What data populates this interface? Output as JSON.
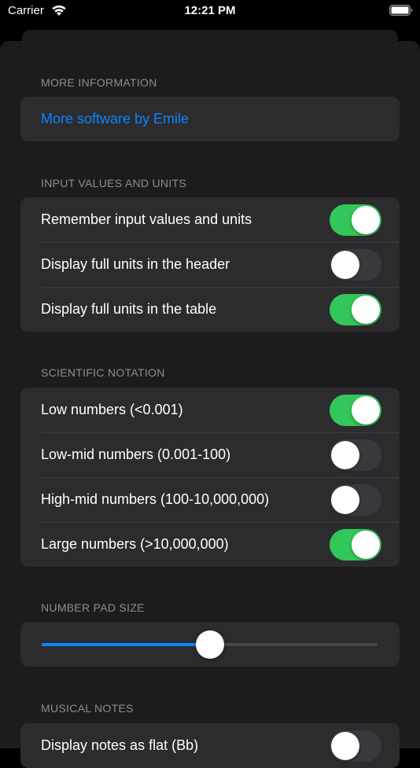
{
  "status_bar": {
    "carrier": "Carrier",
    "time": "12:21 PM"
  },
  "sections": {
    "more_information": {
      "header": "MORE INFORMATION",
      "link": "More software by Emile"
    },
    "input_values": {
      "header": "INPUT VALUES AND UNITS",
      "rows": [
        {
          "label": "Remember input values and units",
          "on": true
        },
        {
          "label": "Display full units in the header",
          "on": false
        },
        {
          "label": "Display full units in the table",
          "on": true
        }
      ]
    },
    "scientific_notation": {
      "header": "SCIENTIFIC NOTATION",
      "rows": [
        {
          "label": "Low numbers (<0.001)",
          "on": true
        },
        {
          "label": "Low-mid numbers (0.001-100)",
          "on": false
        },
        {
          "label": "High-mid numbers (100-10,000,000)",
          "on": false
        },
        {
          "label": "Large numbers (>10,000,000)",
          "on": true
        }
      ]
    },
    "number_pad_size": {
      "header": "NUMBER PAD SIZE",
      "slider_value": 0.5
    },
    "musical_notes": {
      "header": "MUSICAL NOTES",
      "rows": [
        {
          "label": "Display notes as flat (Bb)",
          "on": false
        }
      ]
    }
  },
  "colors": {
    "toggle_on": "#32c759",
    "toggle_off": "#39393d",
    "accent": "#0a84ff",
    "section_header": "#8e8e93"
  }
}
